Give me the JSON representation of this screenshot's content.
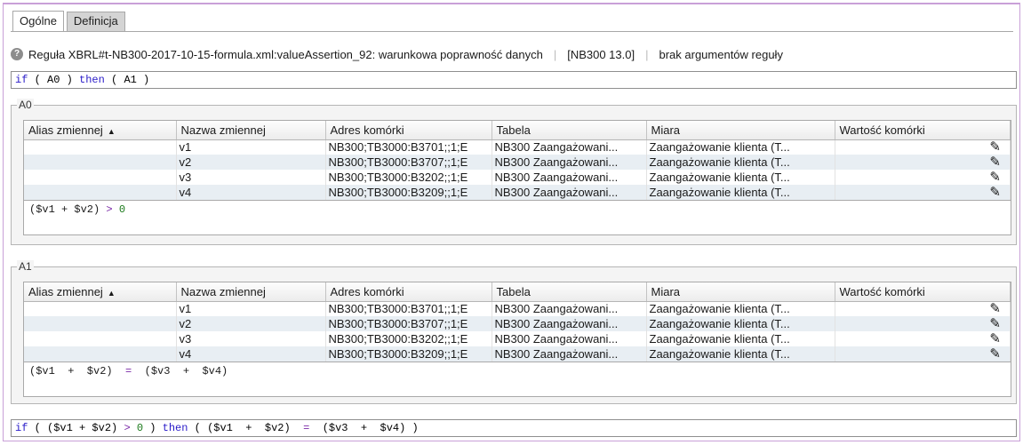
{
  "tabs": [
    {
      "label": "Ogólne",
      "active": true
    },
    {
      "label": "Definicja",
      "active": false
    }
  ],
  "rule": {
    "title": "Reguła XBRL#t-NB300-2017-10-15-formula.xml:valueAssertion_92: warunkowa poprawność danych",
    "version": "[NB300 13.0]",
    "args": "brak argumentów reguły"
  },
  "formula_top": {
    "kw_if": "if",
    "p1": " ( ",
    "a0": "A0",
    "p2": " ) ",
    "kw_then": "then",
    "p3": " ( ",
    "a1": "A1",
    "p4": " )"
  },
  "columns": [
    "Alias zmiennej",
    "Nazwa zmiennej",
    "Adres komórki",
    "Tabela",
    "Miara",
    "Wartość komórki"
  ],
  "groups": [
    {
      "label": "A0",
      "rows": [
        {
          "alias": "",
          "name": "v1",
          "address": "NB300;TB3000:B3701;;1;E",
          "table": "NB300 Zaangażowani...",
          "measure": "Zaangażowanie klienta (T...",
          "value": ""
        },
        {
          "alias": "",
          "name": "v2",
          "address": "NB300;TB3000:B3707;;1;E",
          "table": "NB300 Zaangażowani...",
          "measure": "Zaangażowanie klienta (T...",
          "value": ""
        },
        {
          "alias": "",
          "name": "v3",
          "address": "NB300;TB3000:B3202;;1;E",
          "table": "NB300 Zaangażowani...",
          "measure": "Zaangażowanie klienta (T...",
          "value": ""
        },
        {
          "alias": "",
          "name": "v4",
          "address": "NB300;TB3000:B3209;;1;E",
          "table": "NB300 Zaangażowani...",
          "measure": "Zaangażowanie klienta (T...",
          "value": ""
        }
      ],
      "expr": {
        "t1": "($v1 + $v2) ",
        "op": ">",
        "t2": " ",
        "num": "0"
      }
    },
    {
      "label": "A1",
      "rows": [
        {
          "alias": "",
          "name": "v1",
          "address": "NB300;TB3000:B3701;;1;E",
          "table": "NB300 Zaangażowani...",
          "measure": "Zaangażowanie klienta (T...",
          "value": ""
        },
        {
          "alias": "",
          "name": "v2",
          "address": "NB300;TB3000:B3707;;1;E",
          "table": "NB300 Zaangażowani...",
          "measure": "Zaangażowanie klienta (T...",
          "value": ""
        },
        {
          "alias": "",
          "name": "v3",
          "address": "NB300;TB3000:B3202;;1;E",
          "table": "NB300 Zaangażowani...",
          "measure": "Zaangażowanie klienta (T...",
          "value": ""
        },
        {
          "alias": "",
          "name": "v4",
          "address": "NB300;TB3000:B3209;;1;E",
          "table": "NB300 Zaangażowani...",
          "measure": "Zaangażowanie klienta (T...",
          "value": ""
        }
      ],
      "expr": {
        "t1": "($v1  +  $v2)  ",
        "op": "=",
        "t2": "  ($v3  +  $v4)",
        "num": ""
      }
    }
  ],
  "formula_bottom": {
    "kw_if": "if",
    "p1": " ( ($v1 + $v2) ",
    "op1": ">",
    "s1": " ",
    "num": "0",
    "p2": " ) ",
    "kw_then": "then",
    "p3": " ( ($v1  +  $v2)  ",
    "op2": "=",
    "p4": "  ($v3  +  $v4) )"
  },
  "icons": {
    "help": "help-icon",
    "sort": "sort-ascending-icon",
    "edit": "pencil-icon"
  },
  "colors": {
    "keyword": "#2a1cc9",
    "number": "#1b7a1b",
    "operator": "#7b2aa8",
    "row_alt": "#e8eef3"
  }
}
